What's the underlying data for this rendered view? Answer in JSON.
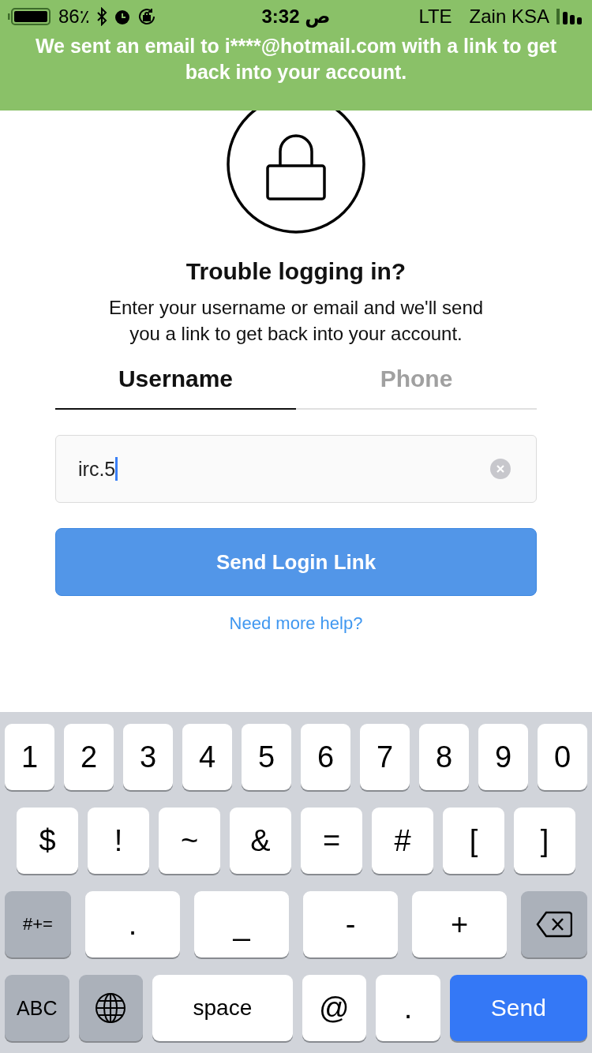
{
  "status_bar": {
    "battery": "86٪",
    "time": "ص 3:32",
    "network": "LTE",
    "carrier": "Zain KSA"
  },
  "banner": {
    "message": "We sent an email to i****@hotmail.com with a link to get back into your account."
  },
  "title": "Trouble logging in?",
  "description": "Enter your username or email and we'll send you a link to get back into your account.",
  "tabs": [
    {
      "label": "Username",
      "selected": true
    },
    {
      "label": "Phone",
      "selected": false
    }
  ],
  "username_field": {
    "value": "irc.5"
  },
  "send_button": "Send Login Link",
  "help_link": "Need more help?",
  "keyboard": {
    "rows": [
      {
        "keys": [
          {
            "kind": "char",
            "label": "1"
          },
          {
            "kind": "char",
            "label": "2"
          },
          {
            "kind": "char",
            "label": "3"
          },
          {
            "kind": "char",
            "label": "4"
          },
          {
            "kind": "char",
            "label": "5"
          },
          {
            "kind": "char",
            "label": "6"
          },
          {
            "kind": "char",
            "label": "7"
          },
          {
            "kind": "char",
            "label": "8"
          },
          {
            "kind": "char",
            "label": "9"
          },
          {
            "kind": "char",
            "label": "0"
          }
        ]
      },
      {
        "keys": [
          {
            "kind": "char",
            "label": "$"
          },
          {
            "kind": "char",
            "label": "!"
          },
          {
            "kind": "char",
            "label": "~"
          },
          {
            "kind": "char",
            "label": "&"
          },
          {
            "kind": "char",
            "label": "="
          },
          {
            "kind": "char",
            "label": "#"
          },
          {
            "kind": "char",
            "label": "["
          },
          {
            "kind": "char",
            "label": "]"
          }
        ]
      },
      {
        "keys": [
          {
            "kind": "function",
            "label": "#+="
          },
          {
            "kind": "char",
            "label": "."
          },
          {
            "kind": "char",
            "label": "_"
          },
          {
            "kind": "char",
            "label": "-"
          },
          {
            "kind": "char",
            "label": "+"
          },
          {
            "kind": "delete"
          }
        ]
      },
      {
        "keys": [
          {
            "kind": "function",
            "label": "ABC"
          },
          {
            "kind": "globe"
          },
          {
            "kind": "char",
            "label": "space"
          },
          {
            "kind": "char",
            "label": "@"
          },
          {
            "kind": "char",
            "label": "."
          },
          {
            "kind": "primary",
            "label": "Send"
          }
        ]
      }
    ]
  }
}
